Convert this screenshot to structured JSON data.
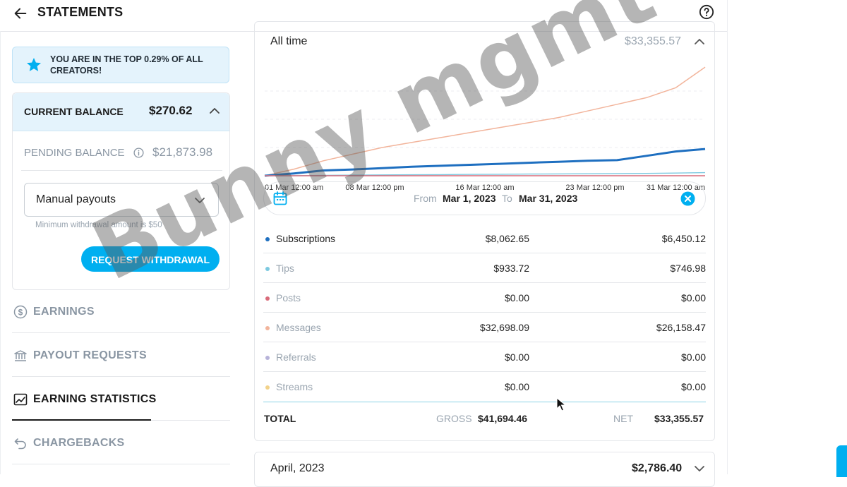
{
  "header": {
    "title": "STATEMENTS",
    "back_icon": "arrow-left-icon",
    "help_icon": "help-circle-icon"
  },
  "banner": {
    "text": "YOU ARE IN THE TOP 0.29% OF ALL CREATORS!",
    "icon": "star-icon"
  },
  "balance": {
    "current_label": "CURRENT BALANCE",
    "current_value": "$270.62",
    "pending_label": "PENDING BALANCE",
    "pending_value": "$21,873.98",
    "payout_select": "Manual payouts",
    "min_note": "Minimum withdrawal amount is $50",
    "withdraw_label": "REQUEST WITHDRAWAL"
  },
  "nav": [
    {
      "label": "EARNINGS",
      "icon": "dollar-circle-icon"
    },
    {
      "label": "PAYOUT REQUESTS",
      "icon": "bank-icon"
    },
    {
      "label": "EARNING STATISTICS",
      "icon": "chart-line-icon",
      "active": true
    },
    {
      "label": "CHARGEBACKS",
      "icon": "undo-icon"
    }
  ],
  "period": {
    "label": "All time",
    "total": "$33,355.57"
  },
  "date_range": {
    "from_label": "From",
    "from": "Mar 1, 2023",
    "to_label": "To",
    "to": "Mar 31, 2023"
  },
  "rows": [
    {
      "name": "Subscriptions",
      "gross": "$8,062.65",
      "net": "$6,450.12",
      "color": "#1e6fc0"
    },
    {
      "name": "Tips",
      "gross": "$933.72",
      "net": "$746.98",
      "color": "#7cc9e0"
    },
    {
      "name": "Posts",
      "gross": "$0.00",
      "net": "$0.00",
      "color": "#d96b7a"
    },
    {
      "name": "Messages",
      "gross": "$32,698.09",
      "net": "$26,158.47",
      "color": "#f2b49b"
    },
    {
      "name": "Referrals",
      "gross": "$0.00",
      "net": "$0.00",
      "color": "#b7b3d9"
    },
    {
      "name": "Streams",
      "gross": "$0.00",
      "net": "$0.00",
      "color": "#f2d28a"
    }
  ],
  "totals": {
    "label": "TOTAL",
    "gross_label": "GROSS",
    "gross": "$41,694.46",
    "net_label": "NET",
    "net": "$33,355.57"
  },
  "next_period": {
    "label": "April, 2023",
    "total": "$2,786.40"
  },
  "watermark": "Bunny mgmt",
  "chart_data": {
    "type": "line",
    "x_ticks": [
      "01 Mar 12:00 am",
      "08 Mar 12:00 pm",
      "16 Mar 12:00 am",
      "23 Mar 12:00 pm",
      "31 Mar 12:00 am"
    ],
    "x": [
      1,
      3,
      5,
      7,
      9,
      11,
      13,
      15,
      17,
      19,
      21,
      23,
      25,
      27,
      29,
      31
    ],
    "grid": "horizontal dashed",
    "series": [
      {
        "name": "Messages",
        "color": "#f2b49b",
        "values": [
          0,
          2000,
          4500,
          6500,
          8500,
          10000,
          11500,
          13000,
          14500,
          16000,
          17500,
          19500,
          21500,
          23500,
          26500,
          32698
        ]
      },
      {
        "name": "Subscriptions",
        "color": "#1e6fc0",
        "values": [
          0,
          700,
          1600,
          1900,
          2300,
          2700,
          3000,
          3300,
          3600,
          3900,
          4200,
          4500,
          4700,
          6000,
          7300,
          8062
        ]
      },
      {
        "name": "Tips",
        "color": "#7cc9e0",
        "values": [
          0,
          0,
          100,
          200,
          250,
          300,
          350,
          400,
          450,
          500,
          550,
          600,
          650,
          700,
          800,
          933
        ]
      },
      {
        "name": "Posts",
        "color": "#d96b7a",
        "values": [
          0,
          0,
          0,
          0,
          0,
          0,
          0,
          0,
          0,
          0,
          0,
          0,
          0,
          0,
          0,
          0
        ]
      }
    ]
  }
}
